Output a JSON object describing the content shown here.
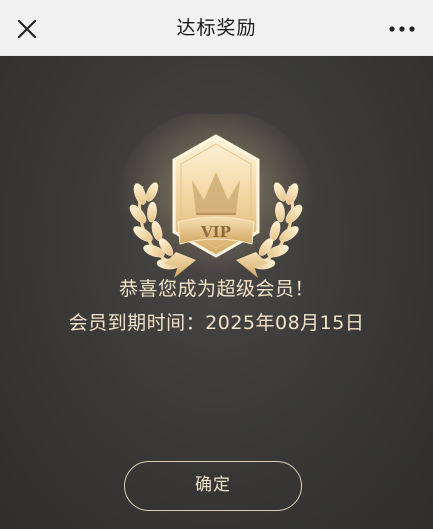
{
  "header": {
    "title": "达标奖励",
    "close_icon": "close-icon",
    "more_icon": "more-dots-icon"
  },
  "reward": {
    "badge_text": "VIP",
    "badge_icon": "vip-crown-laurel-icon",
    "congrats": "恭喜您成为超级会员！",
    "expiry": "会员到期时间：2025年08月15日"
  },
  "actions": {
    "confirm_label": "确定"
  },
  "colors": {
    "background": "#3b3a38",
    "gold_text": "#f1e2c8",
    "badge_gold": "#e9c88e"
  }
}
